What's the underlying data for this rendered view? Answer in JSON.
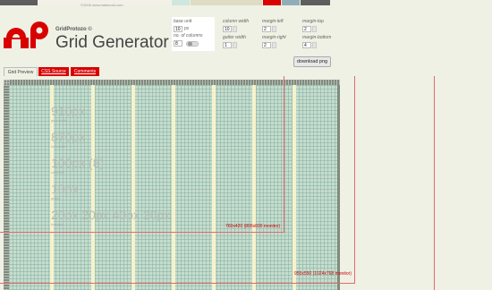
{
  "header": {
    "copyright": "©2008 www.hatebook.com",
    "brand": "GridProtozo ©",
    "title": "Grid Generator"
  },
  "colors": {
    "swatches": [
      "#5e5e5e",
      "#f3f1e7",
      "#cfe7dc",
      "#dfdcc4",
      "#d90000",
      "#91aeb8",
      "#5e5e5e"
    ],
    "accent": "#d90000",
    "grid_background": "#c6dccf",
    "gutter": "#f6f2cc"
  },
  "controls": {
    "base_unit": {
      "label": "base unit",
      "value": "10",
      "unit": "px"
    },
    "no_of_columns": {
      "label": "no. of columns",
      "value": "8"
    },
    "column_width": {
      "label": "column width",
      "value": "10"
    },
    "gutter_width": {
      "label": "gutter width",
      "value": "1"
    },
    "margin_left": {
      "label": "margin-left",
      "value": "2"
    },
    "margin_right": {
      "label": "margin-right",
      "value": "2"
    },
    "margin_top": {
      "label": "margin-top",
      "value": "2"
    },
    "margin_bottom": {
      "label": "margin-bottom",
      "value": "4"
    },
    "download_label": "download png"
  },
  "tabs": [
    {
      "label": "Grid Preview",
      "active": true
    },
    {
      "label": "CSS Source",
      "active": false
    },
    {
      "label": "Comments",
      "active": false
    }
  ],
  "preview": {
    "stats": [
      {
        "big": "910px",
        "small": "grid width"
      },
      {
        "big": "870px",
        "small": "net width"
      },
      {
        "big": "100px (8)",
        "small": "columns"
      },
      {
        "big": "10px",
        "small": "gutter"
      },
      {
        "big": "20px 20px 40px 20px",
        "small": "margins"
      }
    ],
    "monitor_labels": [
      "760x420 (800x600 monitor)",
      "955x550 (1024x768 monitor)"
    ]
  }
}
